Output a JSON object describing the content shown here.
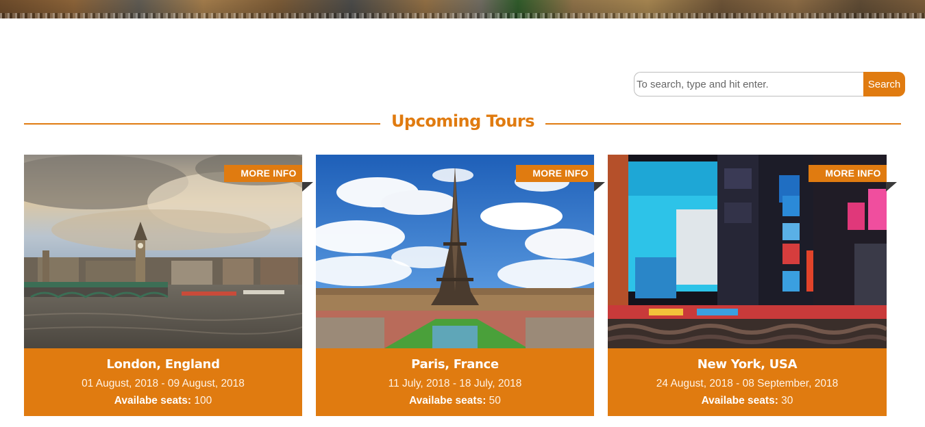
{
  "search": {
    "placeholder": "To search, type and hit enter.",
    "button_label": "Search"
  },
  "section": {
    "title": "Upcoming Tours"
  },
  "tours": [
    {
      "title": "London, England",
      "dates": "01 August, 2018 - 09 August, 2018",
      "seats_label": "Availabe seats:",
      "seats_value": "100",
      "more_info": "MORE INFO"
    },
    {
      "title": "Paris, France",
      "dates": "11 July, 2018 - 18 July, 2018",
      "seats_label": "Availabe seats:",
      "seats_value": "50",
      "more_info": "MORE INFO"
    },
    {
      "title": "New York, USA",
      "dates": "24 August, 2018 - 08 September, 2018",
      "seats_label": "Availabe seats:",
      "seats_value": "30",
      "more_info": "MORE INFO"
    }
  ],
  "colors": {
    "accent": "#e07b10"
  }
}
